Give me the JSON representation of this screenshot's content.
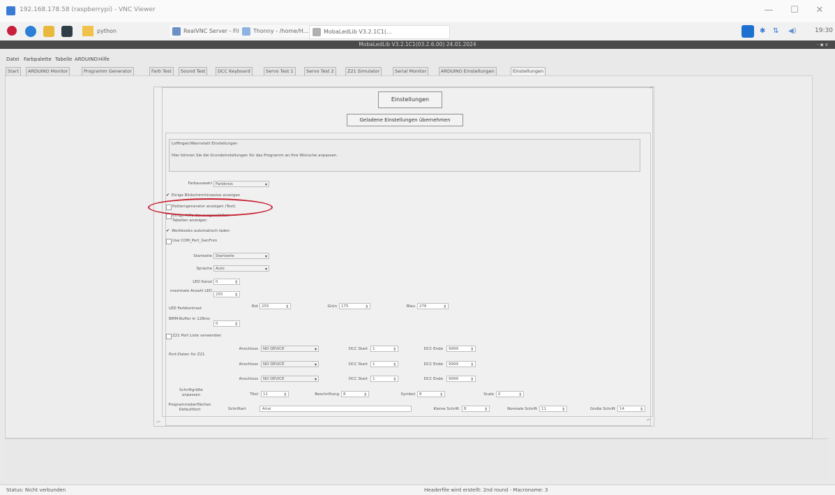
{
  "vnc": {
    "title": "192.168.178.58 (raspberrypi) - VNC Viewer",
    "min": "—",
    "max": "☐",
    "close": "✕"
  },
  "taskbar": {
    "folder_label": "python",
    "tasks": [
      "RealVNC Server - File...",
      "Thonny - /home/H...",
      "MobaLedLib V3.2.1C1(..."
    ],
    "clock": "19:30"
  },
  "app": {
    "title": "MobaLedLib V3.2.1C1(03.2.6.00) 24.01.2024",
    "window_controls": "- ▪ x"
  },
  "menu": [
    "Datei",
    "Farbpalette",
    "Tabelle",
    "ARDUINO",
    "Hilfe"
  ],
  "tabs": [
    "Start",
    "ARDUINO Monitor",
    "Programm Generator",
    "Farb Test",
    "Sound Test",
    "DCC Keyboard",
    "Servo Test 1",
    "Servo Test 2",
    "Z21 Simulator",
    "Serial Monitor",
    "ARDUINO Einstellungen",
    "Einstellungen"
  ],
  "settings": {
    "title_button": "Einstellungen",
    "transfer_button": "Geladene Einstellungen übernehmen",
    "group_title": "Loffingen/Wannstatt Einstellungen",
    "group_text": "Hier können Sie die Grundeinstellungen für das Programm an Ihre Wünsche anpassen.",
    "farbauswahl_label": "Farbauswahl",
    "farbauswahl_value": "Farbkreis",
    "checkboxes": [
      {
        "label": "Einige Bildschirmhinweise anzeigen",
        "checked": true
      },
      {
        "label": "Patterngenerator anzeigen (Test)",
        "checked": false
      },
      {
        "label": "Einige hilfe der ausgewählten Tabellen anzeigen",
        "checked": false
      },
      {
        "label": "Workbooks automatisch laden",
        "checked": true
      },
      {
        "label": "Use COM_Port_GenFnm",
        "checked": false
      }
    ],
    "startseite_label": "Startseite",
    "startseite_value": "Startseite",
    "sprache_label": "Sprache",
    "sprache_value": "Auto",
    "led_kanal_label": "LED Kanal",
    "led_kanal_value": "0",
    "max_led_label": "maximale Anzahl LED",
    "max_led_value": "255",
    "led_farbkontrast_label": "LED Farbkontrast",
    "rot_label": "Rot",
    "rot_value": "255",
    "gruen_label": "Grün",
    "gruen_value": "175",
    "blau_label": "Blau",
    "blau_value": "276",
    "buffer_label": "BMM-Buffer in 128ms",
    "buffer_value": "0",
    "z21_checkbox": "Z21 Port Liste verwenden",
    "port_daten_label": "Port-Daten für Z21",
    "anschluss_label": "Anschluss",
    "anschluss_values": [
      "NO DEVICE",
      "NO DEVICE",
      "NO DEVICE"
    ],
    "dcc_start_label": "DCC Start",
    "dcc_start_values": [
      "1",
      "1",
      "1"
    ],
    "dcc_ende_label": "DCC Ende",
    "dcc_ende_values": [
      "9999",
      "9999",
      "9999"
    ],
    "schrift_label": "Schriftgröße anpassen",
    "titel_label": "Titel",
    "titel_value": "11",
    "beschriftung_label": "Beschriftung",
    "beschriftung_value": "8",
    "symbol_label": "Symbol",
    "symbol_value": "8",
    "scale_label": "Scale",
    "scale_value": "0",
    "prog_font_label": "Programmoberflächen Defaultfont",
    "schriftart_label": "Schriftart",
    "schriftart_value": "Arial",
    "kleine_label": "Kleine Schrift",
    "kleine_value": "8",
    "normale_label": "Normale Schrift",
    "normale_value": "11",
    "grosse_label": "Große Schrift",
    "grosse_value": "14"
  },
  "status": {
    "left": "Status: Nicht verbunden",
    "center": "Headerfile wird erstellt: 2nd round - Macroname: 3"
  },
  "colors": {
    "annotation": "#c61d2d",
    "title_bar": "#4a4a4a",
    "vnc_icon": "#3a7bd5"
  }
}
